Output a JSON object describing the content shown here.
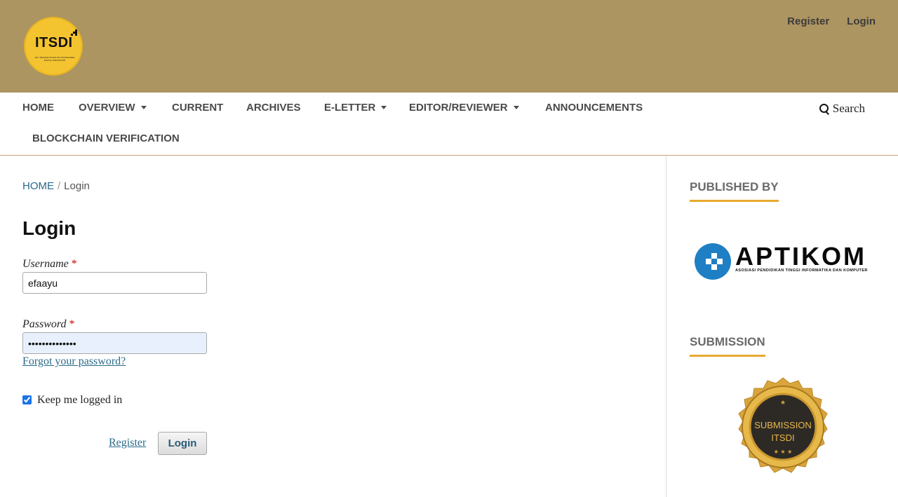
{
  "header": {
    "logo": {
      "text": "ITSDI",
      "subtext": "IAIC TRANSACTIONS ON SUSTAINABLE DIGITAL INNOVATION",
      "color": "#f4c430"
    },
    "background_color": "#ad9561",
    "user_nav": {
      "register": "Register",
      "login": "Login"
    }
  },
  "primary_nav": {
    "items": [
      {
        "label": "HOME",
        "dropdown": false
      },
      {
        "label": "OVERVIEW",
        "dropdown": true
      },
      {
        "label": "CURRENT",
        "dropdown": false
      },
      {
        "label": "ARCHIVES",
        "dropdown": false
      },
      {
        "label": "E-LETTER",
        "dropdown": true
      },
      {
        "label": "EDITOR/REVIEWER",
        "dropdown": true
      },
      {
        "label": "ANNOUNCEMENTS",
        "dropdown": false
      },
      {
        "label": "BLOCKCHAIN VERIFICATION",
        "dropdown": false
      }
    ],
    "search": {
      "label": "Search",
      "icon": "search-icon"
    }
  },
  "breadcrumb": {
    "home": "HOME",
    "separator": "/",
    "current": "Login"
  },
  "login_form": {
    "title": "Login",
    "username": {
      "label": "Username",
      "required_mark": "*",
      "value": "efaayu"
    },
    "password": {
      "label": "Password",
      "required_mark": "*",
      "value": "••••••••••••••"
    },
    "forgot_password": "Forgot your password?",
    "keep_logged_in": {
      "label": "Keep me logged in",
      "checked": true
    },
    "register_link": "Register",
    "login_button": "Login"
  },
  "sidebar": {
    "published_by": {
      "heading": "PUBLISHED BY",
      "logo_name": "APTIKOM",
      "logo_subtext": "ASOSIASI PENDIDIKAN TINGGI INFORMATIKA DAN KOMPUTER"
    },
    "submission": {
      "heading": "SUBMISSION",
      "badge_text_line1": "SUBMISSION",
      "badge_text_line2": "ITSDI"
    },
    "accent_color": "#e8a930"
  }
}
